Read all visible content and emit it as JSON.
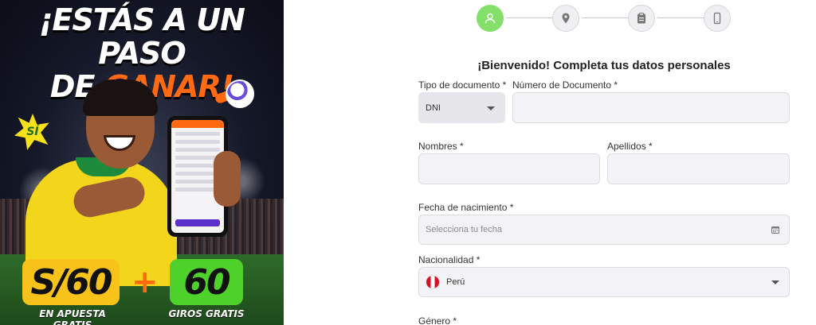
{
  "promo": {
    "title_line1": "¡ESTÁS A UN PASO",
    "title_line2_prefix": "DE ",
    "title_line2_accent": "GANAR!",
    "badge": "SÍ",
    "offer_bet_amount": "S/60",
    "offer_bet_caption": "EN APUESTA GRATIS",
    "offer_spins_amount": "60",
    "offer_spins_caption": "GIROS GRATIS",
    "plus": "+",
    "colors": {
      "accent": "#ff6a13",
      "bet_badge": "#f7c21a",
      "spins_badge": "#4ed12a"
    }
  },
  "stepper": {
    "steps": [
      {
        "icon": "user-icon",
        "state": "active"
      },
      {
        "icon": "location-pin-icon",
        "state": "pending"
      },
      {
        "icon": "clipboard-icon",
        "state": "pending"
      },
      {
        "icon": "mobile-phone-icon",
        "state": "pending"
      }
    ],
    "active_color": "#84e06a"
  },
  "form": {
    "heading": "¡Bienvenido! Completa tus datos personales",
    "document_type": {
      "label": "Tipo de documento *",
      "value": "DNI"
    },
    "document_number": {
      "label": "Número de Documento *",
      "value": ""
    },
    "first_names": {
      "label": "Nombres *",
      "value": ""
    },
    "last_names": {
      "label": "Apellidos *",
      "value": ""
    },
    "birth_date": {
      "label": "Fecha de nacimiento *",
      "placeholder": "Selecciona tu fecha"
    },
    "nationality": {
      "label": "Nacionalidad *",
      "value": "Perú",
      "flag": "peru-flag-icon"
    },
    "gender": {
      "label": "Género *"
    }
  }
}
